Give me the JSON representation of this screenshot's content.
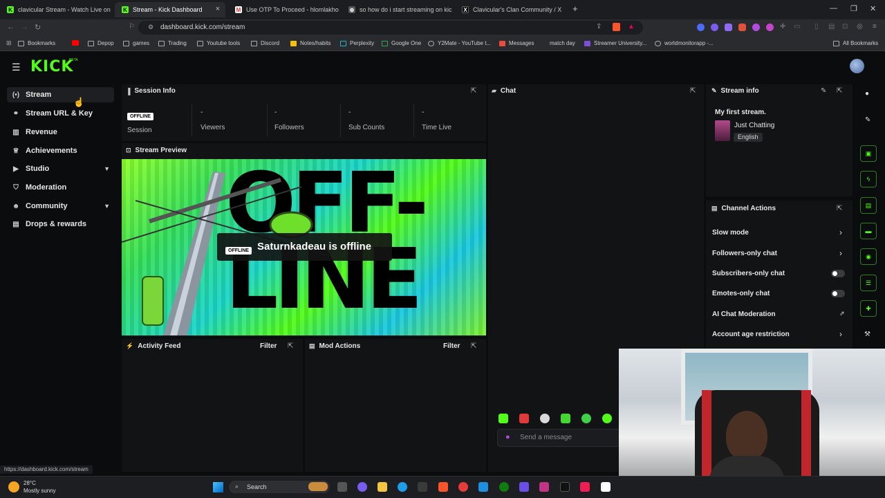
{
  "browser": {
    "tabs": [
      {
        "title": "clavicular Stream - Watch Live on Kic",
        "active": false
      },
      {
        "title": "Stream - Kick Dashboard",
        "active": true
      },
      {
        "title": "Use OTP To Proceed - hlomlakhoza@",
        "active": false
      },
      {
        "title": "so how do i start streaming on kick",
        "active": false
      },
      {
        "title": "Clavicular's Clan Community / X",
        "active": false
      }
    ],
    "url": "dashboard.kick.com/stream",
    "bookmarks": [
      "Bookmarks",
      "Depop",
      "games",
      "Trading",
      "Youtube tools",
      "Discord",
      "Notes/habits",
      "Perplexity",
      "Google One",
      "Y2Mate - YouTube t...",
      "Messages",
      "match day",
      "Streamer University...",
      "worldmonitorapp -..."
    ],
    "all_bookmarks": "All Bookmarks"
  },
  "app": {
    "logo": "KICK",
    "logo_beta": "BETA",
    "nav": [
      {
        "label": "Stream",
        "icon": "broadcast-icon",
        "glyph": "(•)"
      },
      {
        "label": "Stream URL & Key",
        "icon": "link-icon",
        "glyph": "⚭"
      },
      {
        "label": "Revenue",
        "icon": "bar-chart-icon",
        "glyph": "▥"
      },
      {
        "label": "Achievements",
        "icon": "trophy-icon",
        "glyph": "♕"
      },
      {
        "label": "Studio",
        "icon": "video-icon",
        "glyph": "▶"
      },
      {
        "label": "Moderation",
        "icon": "shield-icon",
        "glyph": "⛉"
      },
      {
        "label": "Community",
        "icon": "users-icon",
        "glyph": "☻"
      },
      {
        "label": "Drops & rewards",
        "icon": "gift-icon",
        "glyph": "▤"
      }
    ],
    "session": {
      "title": "Session Info",
      "status_badge": "OFFLINE",
      "session_label": "Session",
      "stats": [
        {
          "value": "-",
          "label": "Viewers"
        },
        {
          "value": "-",
          "label": "Followers"
        },
        {
          "value": "-",
          "label": "Sub Counts"
        },
        {
          "value": "-",
          "label": "Time Live"
        }
      ]
    },
    "preview": {
      "title": "Stream Preview",
      "offline_badge": "OFFLINE",
      "offline_text": "Saturnkadeau is offline",
      "art_text": "OFF-LINE"
    },
    "activity": {
      "title": "Activity Feed",
      "filter": "Filter"
    },
    "mod_actions": {
      "title": "Mod Actions",
      "filter": "Filter"
    },
    "chat": {
      "title": "Chat",
      "placeholder": "Send a message"
    },
    "stream_info": {
      "title": "Stream info",
      "stream_title": "My first stream.",
      "category": "Just Chatting",
      "language": "English"
    },
    "channel_actions": {
      "title": "Channel Actions",
      "items": [
        {
          "label": "Slow mode",
          "type": "arrow"
        },
        {
          "label": "Followers-only chat",
          "type": "arrow"
        },
        {
          "label": "Subscribers-only chat",
          "type": "toggle"
        },
        {
          "label": "Emotes-only chat",
          "type": "toggle"
        },
        {
          "label": "AI Chat Moderation",
          "type": "external"
        },
        {
          "label": "Account age restriction",
          "type": "arrow"
        }
      ]
    }
  },
  "status_bar_url": "https://dashboard.kick.com/stream",
  "taskbar": {
    "weather_temp": "28°C",
    "weather_desc": "Mostly sunny",
    "search": "Search"
  },
  "colors": {
    "accent": "#53fc18",
    "background": "#0b0c0d",
    "panel": "#121315"
  }
}
